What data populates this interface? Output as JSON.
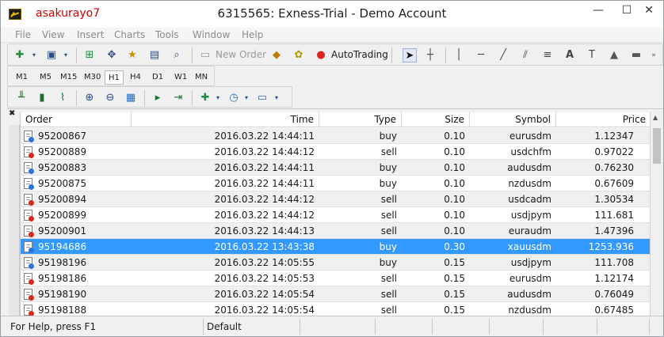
{
  "window": {
    "user": "asakurayo7",
    "title": "6315565: Exness-Trial - Demo Account",
    "min_label": "—",
    "max_label": "☐",
    "close_label": "✕"
  },
  "menu": [
    "File",
    "View",
    "Insert",
    "Charts",
    "Tools",
    "Window",
    "Help"
  ],
  "toolbar": {
    "new_order": "New Order",
    "autotrading": "AutoTrading",
    "text_tool": "A"
  },
  "timeframes": [
    "M1",
    "M5",
    "M15",
    "M30",
    "H1",
    "H4",
    "D1",
    "W1",
    "MN"
  ],
  "active_timeframe": "H1",
  "table": {
    "columns": [
      "Order",
      "Time",
      "Type",
      "Size",
      "Symbol",
      "Price"
    ],
    "rows": [
      {
        "order": "95200867",
        "time": "2016.03.22 14:44:11",
        "type": "buy",
        "size": "0.10",
        "symbol": "eurusdm",
        "price": "1.12347"
      },
      {
        "order": "95200889",
        "time": "2016.03.22 14:44:12",
        "type": "sell",
        "size": "0.10",
        "symbol": "usdchfm",
        "price": "0.97022"
      },
      {
        "order": "95200883",
        "time": "2016.03.22 14:44:11",
        "type": "buy",
        "size": "0.10",
        "symbol": "audusdm",
        "price": "0.76230"
      },
      {
        "order": "95200875",
        "time": "2016.03.22 14:44:11",
        "type": "buy",
        "size": "0.10",
        "symbol": "nzdusdm",
        "price": "0.67609"
      },
      {
        "order": "95200894",
        "time": "2016.03.22 14:44:12",
        "type": "sell",
        "size": "0.10",
        "symbol": "usdcadm",
        "price": "1.30534"
      },
      {
        "order": "95200899",
        "time": "2016.03.22 14:44:12",
        "type": "sell",
        "size": "0.10",
        "symbol": "usdjpym",
        "price": "111.681"
      },
      {
        "order": "95200901",
        "time": "2016.03.22 14:44:13",
        "type": "sell",
        "size": "0.10",
        "symbol": "euraudm",
        "price": "1.47396"
      },
      {
        "order": "95194686",
        "time": "2016.03.22 13:43:38",
        "type": "buy",
        "size": "0.30",
        "symbol": "xauusdm",
        "price": "1253.936"
      },
      {
        "order": "95198196",
        "time": "2016.03.22 14:05:55",
        "type": "buy",
        "size": "0.15",
        "symbol": "usdjpym",
        "price": "111.708"
      },
      {
        "order": "95198186",
        "time": "2016.03.22 14:05:53",
        "type": "sell",
        "size": "0.15",
        "symbol": "eurusdm",
        "price": "1.12174"
      },
      {
        "order": "95198190",
        "time": "2016.03.22 14:05:54",
        "type": "sell",
        "size": "0.15",
        "symbol": "audusdm",
        "price": "0.76049"
      },
      {
        "order": "95198188",
        "time": "2016.03.22 14:05:54",
        "type": "sell",
        "size": "0.15",
        "symbol": "nzdusdm",
        "price": "0.67485"
      }
    ],
    "selected_order": "95194686"
  },
  "status": {
    "help": "For Help, press F1",
    "profile": "Default"
  },
  "colors": {
    "selection": "#3399ff",
    "buy_dot": "#2a74d6",
    "sell_dot": "#d62a1e",
    "user_name": "#d40000"
  }
}
